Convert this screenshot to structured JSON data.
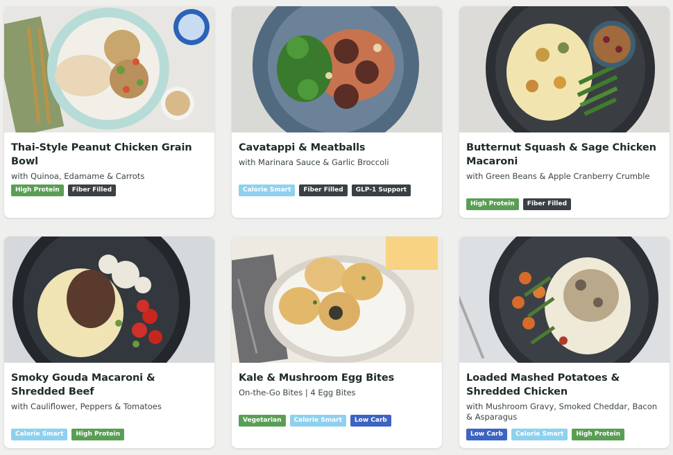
{
  "colors": {
    "high_protein": "#5a9e55",
    "fiber_filled": "#3a4043",
    "calorie_smart": "#8fd0ef",
    "glp1_support": "#3a4043",
    "vegetarian": "#5a9e55",
    "low_carb": "#3d64c2"
  },
  "meals": [
    {
      "title": "Thai-Style Peanut Chicken Grain Bowl",
      "subtitle": "with Quinoa, Edamame & Carrots",
      "tags": [
        "High Protein",
        "Fiber Filled"
      ]
    },
    {
      "title": "Cavatappi & Meatballs",
      "subtitle": "with Marinara Sauce & Garlic Broccoli",
      "tags": [
        "Calorie Smart",
        "Fiber Filled",
        "GLP-1 Support"
      ]
    },
    {
      "title": "Butternut Squash & Sage Chicken Macaroni",
      "subtitle": "with Green Beans & Apple Cranberry Crumble",
      "tags": [
        "High Protein",
        "Fiber Filled"
      ]
    },
    {
      "title": "Smoky Gouda Macaroni & Shredded Beef",
      "subtitle": "with Cauliflower, Peppers & Tomatoes",
      "tags": [
        "Calorie Smart",
        "High Protein"
      ]
    },
    {
      "title": "Kale & Mushroom Egg Bites",
      "subtitle": "On-the-Go Bites | 4 Egg Bites",
      "tags": [
        "Vegetarian",
        "Calorie Smart",
        "Low Carb"
      ]
    },
    {
      "title": "Loaded Mashed Potatoes & Shredded Chicken",
      "subtitle": "with Mushroom Gravy, Smoked Cheddar, Bacon & Asparagus",
      "tags": [
        "Low Carb",
        "Calorie Smart",
        "High Protein"
      ]
    }
  ]
}
